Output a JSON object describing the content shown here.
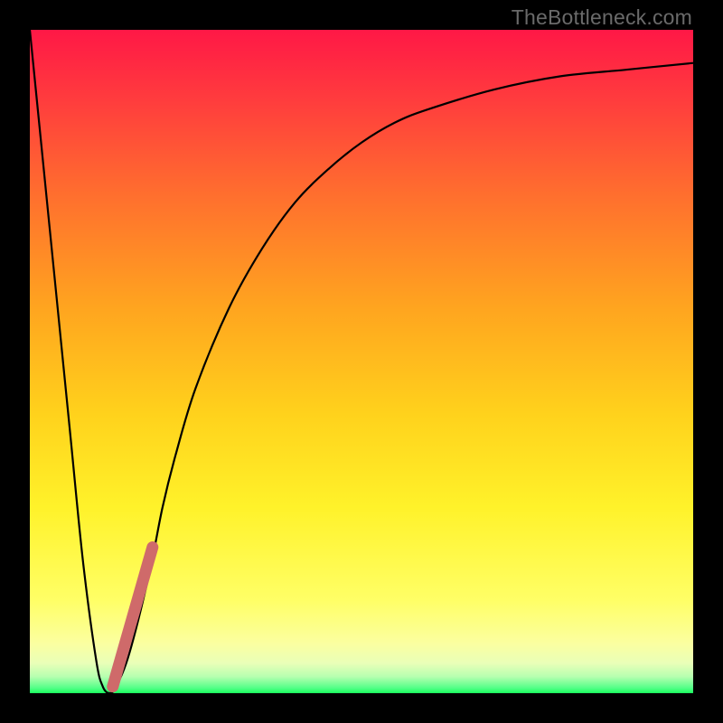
{
  "watermark": "TheBottleneck.com",
  "colors": {
    "band_top": "#ff1f4b",
    "band_mid1": "#ff7a2a",
    "band_mid2": "#ffd21c",
    "band_mid3": "#ffff66",
    "band_pale": "#f2ffb0",
    "band_green": "#2bff6a",
    "curve": "#000000",
    "marker": "#cf6a6a",
    "frame": "#000000"
  },
  "chart_data": {
    "type": "line",
    "title": "",
    "xlabel": "",
    "ylabel": "",
    "xlim": [
      0,
      100
    ],
    "ylim": [
      0,
      100
    ],
    "grid": false,
    "notes": "Vertical gradient background represents severity bands (red=high bottleneck, green=optimal). Curve is bottleneck % vs some x parameter. Red marker segment highlights a specific range on the rising limb near the bottom.",
    "series": [
      {
        "name": "bottleneck-curve",
        "x": [
          0,
          3,
          6,
          8,
          10,
          11,
          12,
          13,
          15,
          18,
          20,
          22,
          25,
          30,
          35,
          40,
          45,
          50,
          55,
          60,
          70,
          80,
          90,
          100
        ],
        "y": [
          100,
          70,
          40,
          20,
          5,
          1,
          0,
          1,
          6,
          18,
          28,
          36,
          46,
          58,
          67,
          74,
          79,
          83,
          86,
          88,
          91,
          93,
          94,
          95
        ]
      }
    ],
    "marker_segment": {
      "name": "highlight",
      "x": [
        12.5,
        18.5
      ],
      "y": [
        1,
        22
      ]
    },
    "color_bands": [
      {
        "y_from": 95,
        "y_to": 100,
        "color": "#ff1f4b"
      },
      {
        "y_from": 60,
        "y_to": 95,
        "color": "#ff7a2a"
      },
      {
        "y_from": 30,
        "y_to": 60,
        "color": "#ffd21c"
      },
      {
        "y_from": 10,
        "y_to": 30,
        "color": "#ffff66"
      },
      {
        "y_from": 3,
        "y_to": 10,
        "color": "#f2ffb0"
      },
      {
        "y_from": 0,
        "y_to": 3,
        "color": "#2bff6a"
      }
    ]
  }
}
